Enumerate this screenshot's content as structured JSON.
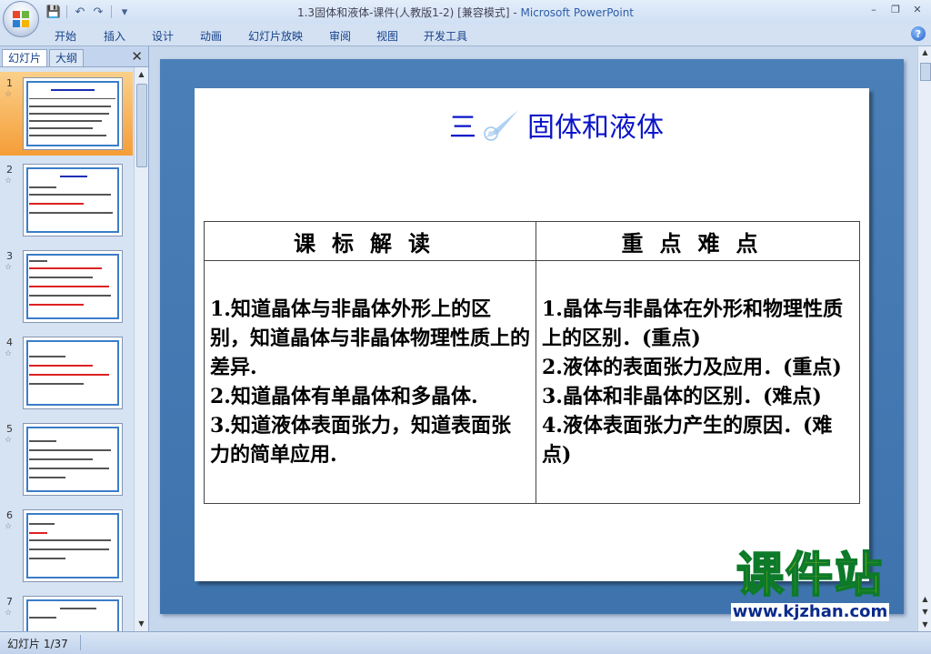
{
  "window": {
    "title_doc": "1.3固体和液体-课件(人教版1-2) [兼容模式] - ",
    "title_app": "Microsoft PowerPoint",
    "controls": [
      "–",
      "❐",
      "✕"
    ]
  },
  "qat": {
    "save_icon": "💾",
    "undo_icon": "↶",
    "redo_icon": "↷",
    "more_icon": "▾"
  },
  "ribbon": {
    "tabs": [
      "开始",
      "插入",
      "设计",
      "动画",
      "幻灯片放映",
      "审阅",
      "视图",
      "开发工具"
    ],
    "help": "?"
  },
  "left_pane": {
    "tabs": [
      "幻灯片",
      "大纲"
    ],
    "close": "✕",
    "thumbnails": [
      {
        "num": "1",
        "star": "☆"
      },
      {
        "num": "2",
        "star": "☆"
      },
      {
        "num": "3",
        "star": "☆"
      },
      {
        "num": "4",
        "star": "☆"
      },
      {
        "num": "5",
        "star": "☆"
      },
      {
        "num": "6",
        "star": "☆"
      },
      {
        "num": "7",
        "star": "☆"
      }
    ]
  },
  "slide": {
    "title_num": "三",
    "title_text": "固体和液体",
    "table": {
      "headers": [
        "课标解读",
        "重点难点"
      ],
      "left": "1.知道晶体与非晶体外形上的区别，知道晶体与非晶体物理性质上的差异.\n2.知道晶体有单晶体和多晶体.\n3.知道液体表面张力，知道表面张力的简单应用.",
      "right": "1.晶体与非晶体在外形和物理性质上的区别．(重点)\n2.液体的表面张力及应用．(重点)\n3.晶体和非晶体的区别．(难点)\n4.液体表面张力产生的原因．(难点)"
    }
  },
  "watermark": {
    "big": "课件站",
    "url": "www.kjzhan.com"
  },
  "status": {
    "slide_info": "幻灯片 1/37"
  },
  "colors": {
    "slide_bg": "#4a7fb7",
    "title_blue": "#0a14c8",
    "selected_thumb": "#f59d38"
  }
}
